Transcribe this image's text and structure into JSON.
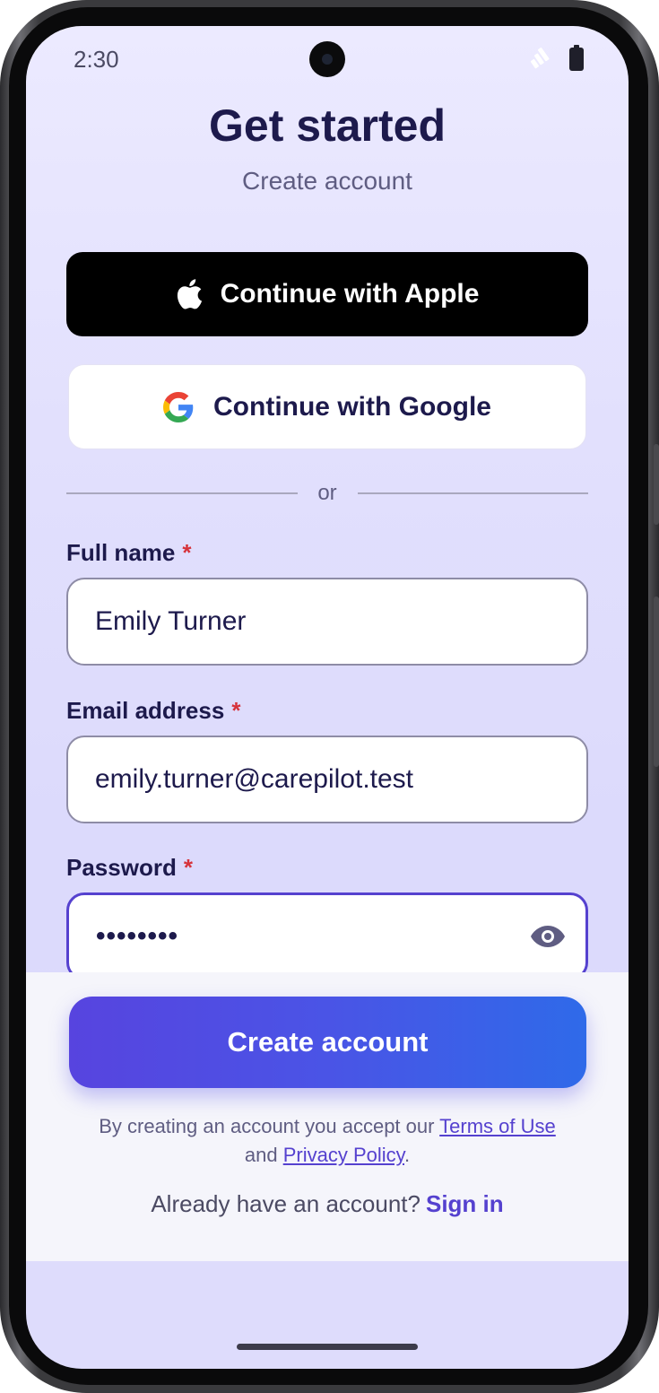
{
  "status_bar": {
    "time": "2:30",
    "icons": [
      "camera-icon",
      "signal-icon",
      "battery-icon"
    ]
  },
  "header": {
    "title": "Get started",
    "subtitle": "Create account"
  },
  "social": {
    "apple_label": "Continue with Apple",
    "google_label": "Continue with Google"
  },
  "divider": {
    "text": "or"
  },
  "form": {
    "full_name": {
      "label": "Full name",
      "required_mark": "*",
      "value": "Emily Turner"
    },
    "email": {
      "label": "Email address",
      "required_mark": "*",
      "value": "emily.turner@carepilot.test"
    },
    "password": {
      "label": "Password",
      "required_mark": "*",
      "masked_value": "••••••••",
      "toggle_icon": "eye-icon"
    }
  },
  "footer": {
    "create_button": "Create account",
    "legal_prefix": "By creating an account you accept our",
    "terms_link": "Terms of Use",
    "legal_and": "and",
    "privacy_link": "Privacy Policy",
    "legal_suffix": ".",
    "signin_prompt": "Already have an account?",
    "signin_link": "Sign in"
  },
  "colors": {
    "accent": "#5541cf",
    "heading": "#1d1a4c",
    "required": "#d6333b",
    "gradient_start": "#5744df",
    "gradient_end": "#2f6ae9"
  }
}
